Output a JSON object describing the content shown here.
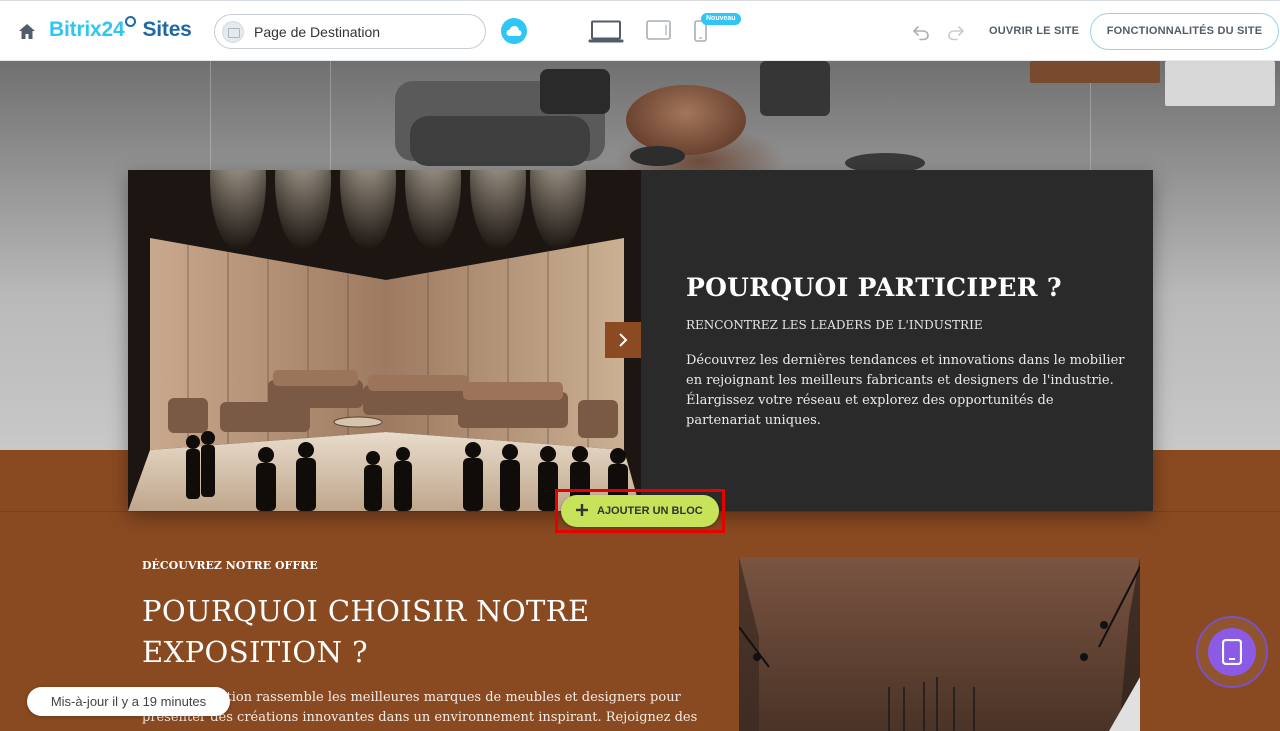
{
  "header": {
    "logo_brand": "Bitrix24",
    "logo_sites": "Sites",
    "page_name": "Page de Destination",
    "badge_new": "Nouveau",
    "open_site_label": "OUVRIR LE SITE",
    "features_label": "FONCTIONNALITÉS DU SITE"
  },
  "hero_card": {
    "title": "POURQUOI PARTICIPER ?",
    "subtitle": "RENCONTREZ LES LEADERS DE L'INDUSTRIE",
    "text": "Découvrez les dernières tendances et innovations dans le mobilier en rejoignant les meilleurs fabricants et designers de l'industrie. Élargissez votre réseau et explorez des opportunités de partenariat uniques."
  },
  "add_block": {
    "label": "AJOUTER UN BLOC"
  },
  "offer_section": {
    "eyebrow": "DÉCOUVREZ NOTRE OFFRE",
    "title": "POURQUOI CHOISIR NOTRE EXPOSITION ?",
    "text": "Notre exposition rassemble les meilleures marques de meubles et designers pour présenter des créations innovantes dans un environnement inspirant. Rejoignez des professionnels partageant"
  },
  "status": {
    "updated": "Mis-à-jour il y a 19 minutes"
  },
  "colors": {
    "brand_blue": "#2fc6f6",
    "section_brown": "#8a4a21",
    "card_dark": "#2a2a2a",
    "add_block_green": "#c6e35a",
    "highlight_red": "#e80000",
    "fab_purple": "#8b5be6"
  },
  "icons": {
    "home": "home-icon",
    "cloud": "cloud-icon",
    "desktop": "laptop-icon",
    "tablet": "tablet-icon",
    "phone": "phone-icon",
    "undo": "undo-icon",
    "redo": "redo-icon",
    "next": "chevron-right-icon",
    "plus": "plus-icon",
    "mobile_preview": "mobile-preview-icon"
  }
}
